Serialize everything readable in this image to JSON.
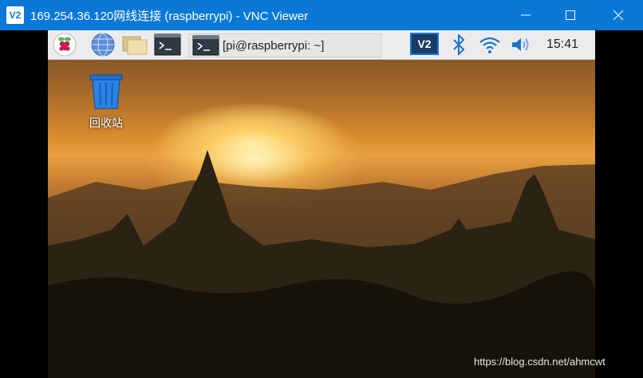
{
  "window": {
    "title": "169.254.36.120网线连接 (raspberrypi) - VNC Viewer",
    "app_icon_text": "V2",
    "controls": {
      "minimize": "—",
      "maximize": "☐",
      "close": "✕"
    }
  },
  "panel": {
    "launchers": [
      {
        "name": "raspberry-menu-icon"
      },
      {
        "name": "web-browser-icon"
      },
      {
        "name": "file-manager-icon"
      },
      {
        "name": "terminal-icon"
      }
    ],
    "taskbar_item": {
      "label": "[pi@raspberrypi: ~]"
    },
    "tray": {
      "vnc_text": "V2",
      "clock": "15:41"
    }
  },
  "desktop": {
    "icons": [
      {
        "label": "回收站",
        "icon": "trash-icon"
      }
    ]
  },
  "watermark": "https://blog.csdn.net/ahmcwt",
  "colors": {
    "titlebar": "#0a78d7",
    "panel": "#ececec"
  }
}
